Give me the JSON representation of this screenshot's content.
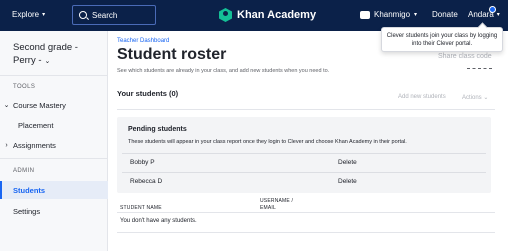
{
  "topnav": {
    "explore_label": "Explore",
    "search_label": "Search",
    "brand": "Khan Academy",
    "khanmigo_label": "Khanmigo",
    "donate_label": "Donate",
    "user_label": "Andara"
  },
  "sidebar": {
    "class_name": "Second grade - Perry -",
    "tools_label": "TOOLS",
    "admin_label": "ADMIN",
    "items": [
      {
        "label": "Course Mastery"
      },
      {
        "label": "Placement"
      },
      {
        "label": "Assignments"
      },
      {
        "label": "Students"
      },
      {
        "label": "Settings"
      }
    ]
  },
  "main": {
    "breadcrumb": "Teacher Dashboard",
    "title": "Student roster",
    "subtitle": "See which students are already in your class, and add new students when you need to.",
    "share_link": "Share class code",
    "tooltip": "Clever students join your class by logging into their Clever portal.",
    "your_students": "Your students (0)",
    "add_new_label": "Add new students",
    "actions_label": "Actions",
    "pending": {
      "title": "Pending students",
      "description": "These students will appear in your class report once they login to Clever and choose Khan Academy in their portal.",
      "rows": [
        {
          "name": "Bobby P",
          "action": "Delete"
        },
        {
          "name": "Rebecca D",
          "action": "Delete"
        }
      ]
    },
    "table": {
      "col_name": "STUDENT NAME",
      "col_username": "USERNAME / EMAIL",
      "empty": "You don't have any students."
    }
  },
  "colors": {
    "nav_bg": "#0b2149",
    "accent": "#1865f2",
    "brand_green": "#14bf96"
  }
}
